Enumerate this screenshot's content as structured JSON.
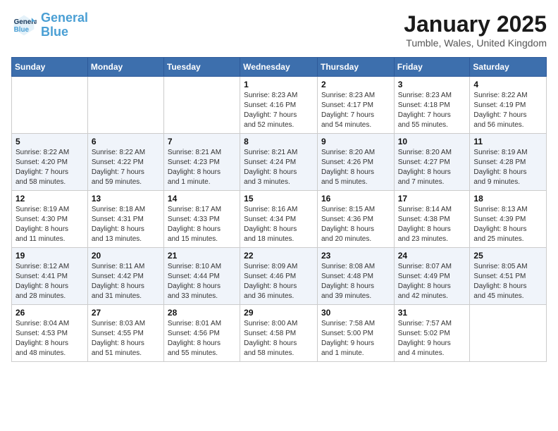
{
  "header": {
    "logo_line1": "General",
    "logo_line2": "Blue",
    "month": "January 2025",
    "location": "Tumble, Wales, United Kingdom"
  },
  "days_of_week": [
    "Sunday",
    "Monday",
    "Tuesday",
    "Wednesday",
    "Thursday",
    "Friday",
    "Saturday"
  ],
  "weeks": [
    [
      {
        "day": "",
        "info": ""
      },
      {
        "day": "",
        "info": ""
      },
      {
        "day": "",
        "info": ""
      },
      {
        "day": "1",
        "info": "Sunrise: 8:23 AM\nSunset: 4:16 PM\nDaylight: 7 hours\nand 52 minutes."
      },
      {
        "day": "2",
        "info": "Sunrise: 8:23 AM\nSunset: 4:17 PM\nDaylight: 7 hours\nand 54 minutes."
      },
      {
        "day": "3",
        "info": "Sunrise: 8:23 AM\nSunset: 4:18 PM\nDaylight: 7 hours\nand 55 minutes."
      },
      {
        "day": "4",
        "info": "Sunrise: 8:22 AM\nSunset: 4:19 PM\nDaylight: 7 hours\nand 56 minutes."
      }
    ],
    [
      {
        "day": "5",
        "info": "Sunrise: 8:22 AM\nSunset: 4:20 PM\nDaylight: 7 hours\nand 58 minutes."
      },
      {
        "day": "6",
        "info": "Sunrise: 8:22 AM\nSunset: 4:22 PM\nDaylight: 7 hours\nand 59 minutes."
      },
      {
        "day": "7",
        "info": "Sunrise: 8:21 AM\nSunset: 4:23 PM\nDaylight: 8 hours\nand 1 minute."
      },
      {
        "day": "8",
        "info": "Sunrise: 8:21 AM\nSunset: 4:24 PM\nDaylight: 8 hours\nand 3 minutes."
      },
      {
        "day": "9",
        "info": "Sunrise: 8:20 AM\nSunset: 4:26 PM\nDaylight: 8 hours\nand 5 minutes."
      },
      {
        "day": "10",
        "info": "Sunrise: 8:20 AM\nSunset: 4:27 PM\nDaylight: 8 hours\nand 7 minutes."
      },
      {
        "day": "11",
        "info": "Sunrise: 8:19 AM\nSunset: 4:28 PM\nDaylight: 8 hours\nand 9 minutes."
      }
    ],
    [
      {
        "day": "12",
        "info": "Sunrise: 8:19 AM\nSunset: 4:30 PM\nDaylight: 8 hours\nand 11 minutes."
      },
      {
        "day": "13",
        "info": "Sunrise: 8:18 AM\nSunset: 4:31 PM\nDaylight: 8 hours\nand 13 minutes."
      },
      {
        "day": "14",
        "info": "Sunrise: 8:17 AM\nSunset: 4:33 PM\nDaylight: 8 hours\nand 15 minutes."
      },
      {
        "day": "15",
        "info": "Sunrise: 8:16 AM\nSunset: 4:34 PM\nDaylight: 8 hours\nand 18 minutes."
      },
      {
        "day": "16",
        "info": "Sunrise: 8:15 AM\nSunset: 4:36 PM\nDaylight: 8 hours\nand 20 minutes."
      },
      {
        "day": "17",
        "info": "Sunrise: 8:14 AM\nSunset: 4:38 PM\nDaylight: 8 hours\nand 23 minutes."
      },
      {
        "day": "18",
        "info": "Sunrise: 8:13 AM\nSunset: 4:39 PM\nDaylight: 8 hours\nand 25 minutes."
      }
    ],
    [
      {
        "day": "19",
        "info": "Sunrise: 8:12 AM\nSunset: 4:41 PM\nDaylight: 8 hours\nand 28 minutes."
      },
      {
        "day": "20",
        "info": "Sunrise: 8:11 AM\nSunset: 4:42 PM\nDaylight: 8 hours\nand 31 minutes."
      },
      {
        "day": "21",
        "info": "Sunrise: 8:10 AM\nSunset: 4:44 PM\nDaylight: 8 hours\nand 33 minutes."
      },
      {
        "day": "22",
        "info": "Sunrise: 8:09 AM\nSunset: 4:46 PM\nDaylight: 8 hours\nand 36 minutes."
      },
      {
        "day": "23",
        "info": "Sunrise: 8:08 AM\nSunset: 4:48 PM\nDaylight: 8 hours\nand 39 minutes."
      },
      {
        "day": "24",
        "info": "Sunrise: 8:07 AM\nSunset: 4:49 PM\nDaylight: 8 hours\nand 42 minutes."
      },
      {
        "day": "25",
        "info": "Sunrise: 8:05 AM\nSunset: 4:51 PM\nDaylight: 8 hours\nand 45 minutes."
      }
    ],
    [
      {
        "day": "26",
        "info": "Sunrise: 8:04 AM\nSunset: 4:53 PM\nDaylight: 8 hours\nand 48 minutes."
      },
      {
        "day": "27",
        "info": "Sunrise: 8:03 AM\nSunset: 4:55 PM\nDaylight: 8 hours\nand 51 minutes."
      },
      {
        "day": "28",
        "info": "Sunrise: 8:01 AM\nSunset: 4:56 PM\nDaylight: 8 hours\nand 55 minutes."
      },
      {
        "day": "29",
        "info": "Sunrise: 8:00 AM\nSunset: 4:58 PM\nDaylight: 8 hours\nand 58 minutes."
      },
      {
        "day": "30",
        "info": "Sunrise: 7:58 AM\nSunset: 5:00 PM\nDaylight: 9 hours\nand 1 minute."
      },
      {
        "day": "31",
        "info": "Sunrise: 7:57 AM\nSunset: 5:02 PM\nDaylight: 9 hours\nand 4 minutes."
      },
      {
        "day": "",
        "info": ""
      }
    ]
  ]
}
